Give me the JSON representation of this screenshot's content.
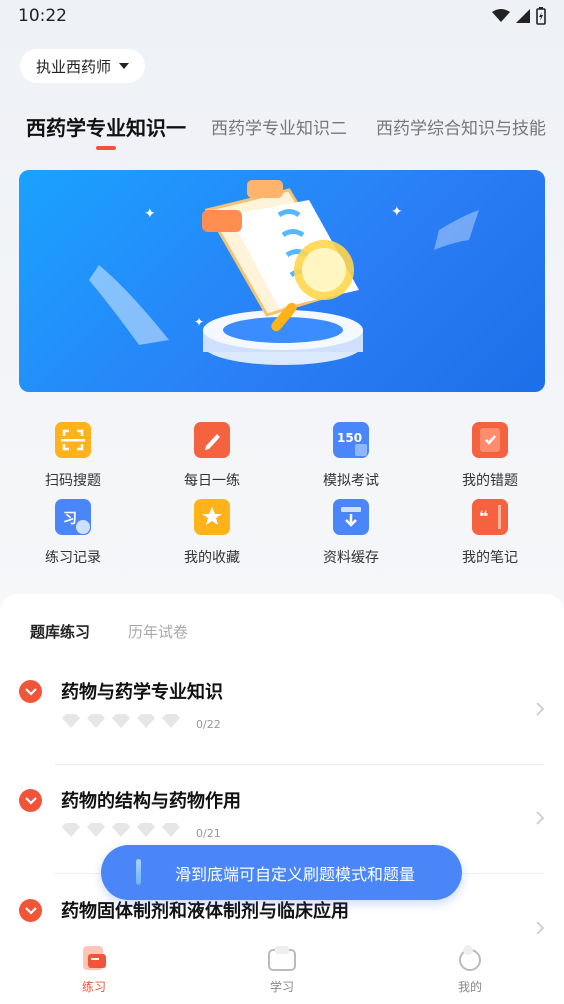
{
  "status_bar": {
    "time": "10:22"
  },
  "selector": {
    "label": "执业西药师"
  },
  "subject_tabs": [
    {
      "label": "西药学专业知识一",
      "active": true
    },
    {
      "label": "西药学专业知识二",
      "active": false
    },
    {
      "label": "西药学综合知识与技能",
      "active": false
    }
  ],
  "grid": [
    {
      "label": "扫码搜题",
      "icon": "scan-icon",
      "color": "#ffb21a"
    },
    {
      "label": "每日一练",
      "icon": "pencil-icon",
      "color": "#f4623f"
    },
    {
      "label": "模拟考试",
      "icon": "exam-150-icon",
      "color": "#4a86f7"
    },
    {
      "label": "我的错题",
      "icon": "wrong-book-icon",
      "color": "#f4623f"
    },
    {
      "label": "练习记录",
      "icon": "record-icon",
      "color": "#4a86f7"
    },
    {
      "label": "我的收藏",
      "icon": "star-icon",
      "color": "#ffb21a"
    },
    {
      "label": "资料缓存",
      "icon": "download-icon",
      "color": "#4a86f7"
    },
    {
      "label": "我的笔记",
      "icon": "notes-icon",
      "color": "#f4623f"
    }
  ],
  "panel": {
    "tabs": [
      {
        "label": "题库练习",
        "active": true
      },
      {
        "label": "历年试卷",
        "active": false
      }
    ],
    "chapters": [
      {
        "title": "药物与药学专业知识",
        "progress": "0/22"
      },
      {
        "title": "药物的结构与药物作用",
        "progress": "0/21"
      },
      {
        "title": "药物固体制剂和液体制剂与临床应用",
        "progress": ""
      }
    ]
  },
  "toast": {
    "text": "滑到底端可自定义刷题模式和题量"
  },
  "bottom_nav": [
    {
      "label": "练习",
      "icon": "practice-icon",
      "active": true
    },
    {
      "label": "学习",
      "icon": "study-icon",
      "active": false
    },
    {
      "label": "我的",
      "icon": "profile-icon",
      "active": false
    }
  ],
  "colors": {
    "accent": "#f0553a",
    "primary_blue": "#4a86f7"
  }
}
